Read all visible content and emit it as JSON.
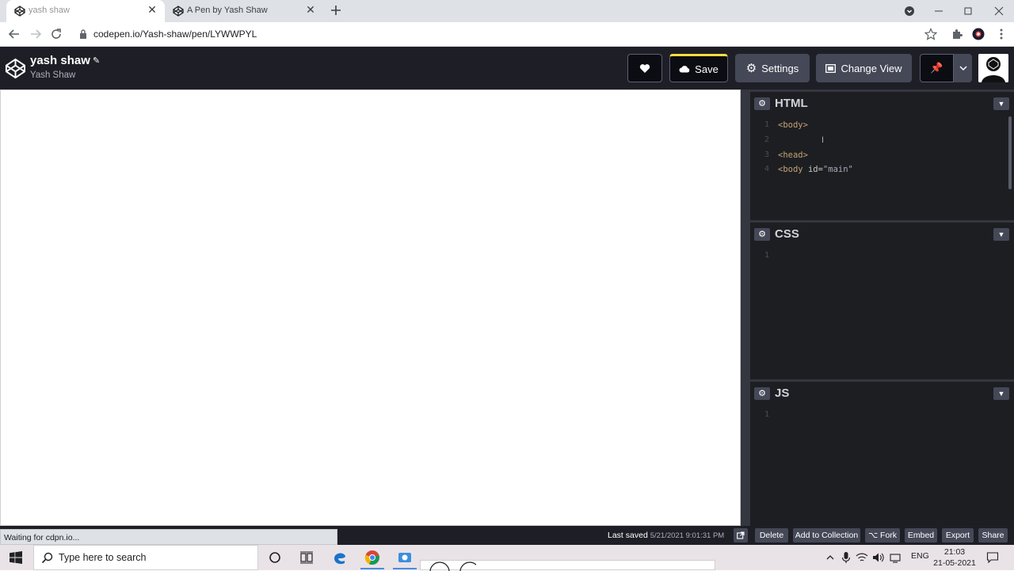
{
  "browser": {
    "tabs": [
      {
        "title": "yash shaw",
        "active": true
      },
      {
        "title": "A Pen by Yash Shaw",
        "active": false
      }
    ],
    "url": "codepen.io/Yash-shaw/pen/LYWWPYL"
  },
  "header": {
    "pen_title": "yash shaw",
    "author": "Yash Shaw",
    "buttons": {
      "save": "Save",
      "settings": "Settings",
      "change_view": "Change View"
    }
  },
  "editors": {
    "html": {
      "name": "HTML",
      "line_numbers": [
        "1",
        "2",
        "3",
        "4"
      ],
      "lines": {
        "l1": "<body>",
        "l3": "<head>",
        "l4_tag": "<body ",
        "l4_attr": "id",
        "l4_eq": "=",
        "l4_val": "\"main\""
      }
    },
    "css": {
      "name": "CSS",
      "line_numbers": [
        "1"
      ]
    },
    "js": {
      "name": "JS",
      "line_numbers": [
        "1"
      ]
    }
  },
  "footer": {
    "status": "Waiting for cdpn.io...",
    "last_saved_label": "Last saved",
    "last_saved_time": "5/21/2021 9:01:31 PM",
    "buttons": {
      "delete": "Delete",
      "add_to_collection": "Add to Collection",
      "fork": "Fork",
      "embed": "Embed",
      "export": "Export",
      "share": "Share"
    }
  },
  "taskbar": {
    "search_placeholder": "Type here to search",
    "language": "ENG",
    "time": "21:03",
    "date": "21-05-2021"
  },
  "colors": {
    "codepen_header": "#1e1f26",
    "button_bg": "#444857",
    "save_accent": "#ffdd40",
    "editor_bg": "#1d1e22"
  }
}
